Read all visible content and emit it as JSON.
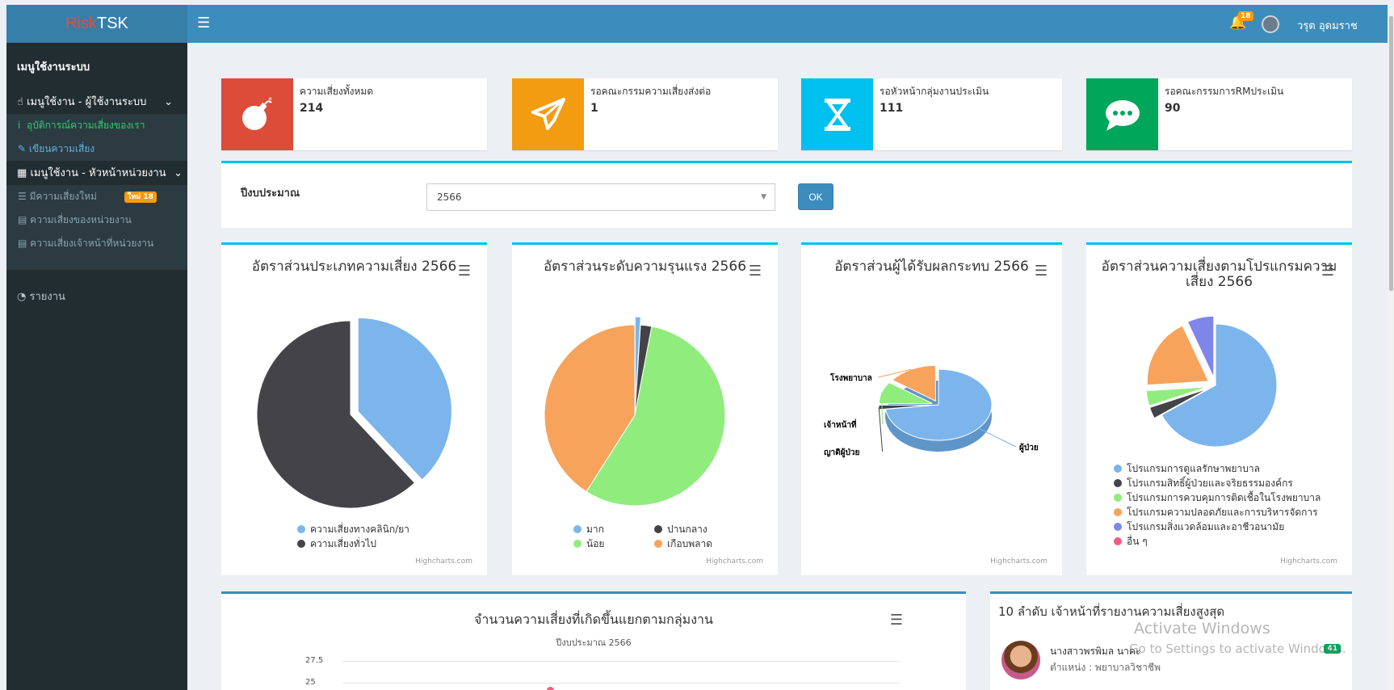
{
  "app": {
    "logo_risk": "Risk",
    "logo_tsk": "TSK"
  },
  "topbar": {
    "notif_count": "18",
    "username": "วรุต อุดมราช"
  },
  "sidebar": {
    "header": "เมนูใช้งานระบบ",
    "group1": "เมนูใช้งาน - ผู้ใช้งานระบบ",
    "group1_items": [
      "อุบัติการณ์ความเสี่ยงของเรา",
      "เขียนความเสี่ยง"
    ],
    "group2": "เมนูใช้งาน - หัวหน้าหน่วยงาน",
    "group2_items": [
      "มีความเสี่ยงใหม่",
      "ความเสี่ยงของหน่วยงาน",
      "ความเสี่ยงเจ้าหน้าที่หน่วยงาน"
    ],
    "new_badge": "ใหม่ 18",
    "report": "รายงาน"
  },
  "info_boxes": [
    {
      "title": "ความเสี่ยงทั้งหมด",
      "value": "214",
      "color": "#dd4b39",
      "icon": "bomb-icon"
    },
    {
      "title": "รอคณะกรรมความเสี่ยงส่งต่อ",
      "value": "1",
      "color": "#f39c12",
      "icon": "paper-plane-icon"
    },
    {
      "title": "รอหัวหน้ากลุ่มงานประเมิน",
      "value": "111",
      "color": "#00c0ef",
      "icon": "hourglass-icon"
    },
    {
      "title": "รอคณะกรรมการRMประเมิน",
      "value": "90",
      "color": "#00a65a",
      "icon": "comment-icon"
    }
  ],
  "filter": {
    "label": "ปีงบประมาณ",
    "selected": "2566",
    "ok_label": "OK"
  },
  "charts": {
    "credit": "Highcharts.com",
    "c1_title": "อัตราส่วนประเภทความเสี่ยง 2566",
    "c2_title": "อัตราส่วนระดับความรุนแรง 2566",
    "c3_title": "อัตราส่วนผู้ได้รับผลกระทบ 2566",
    "c4_title": "อัตราส่วนความเสี่ยงตามโปรแกรมความเสี่ยง 2566"
  },
  "chart_data": [
    {
      "type": "pie",
      "title": "อัตราส่วนประเภทความเสี่ยง 2566",
      "categories": [
        "ความเสี่ยงทางคลินิก/ยา",
        "ความเสี่ยงทั่วไป"
      ],
      "values": [
        38,
        62
      ],
      "colors": [
        "#7cb5ec",
        "#434348"
      ]
    },
    {
      "type": "pie",
      "title": "อัตราส่วนระดับความรุนแรง 2566",
      "categories": [
        "มาก",
        "ปานกลาง",
        "น้อย",
        "เกือบพลาด"
      ],
      "values": [
        1,
        2,
        56,
        41
      ],
      "colors": [
        "#7cb5ec",
        "#434348",
        "#90ed7d",
        "#f7a35c"
      ]
    },
    {
      "type": "pie",
      "title": "อัตราส่วนผู้ได้รับผลกระทบ 2566",
      "categories": [
        "ผู้ป่วย",
        "ญาติผู้ป่วย",
        "เจ้าหน้าที่",
        "โรงพยาบาล"
      ],
      "values": [
        73,
        2,
        10,
        15
      ],
      "colors": [
        "#7cb5ec",
        "#434348",
        "#90ed7d",
        "#f7a35c"
      ]
    },
    {
      "type": "pie",
      "title": "อัตราส่วนความเสี่ยงตามโปรแกรมความเสี่ยง 2566",
      "categories": [
        "โปรแกรมการดูแลรักษาพยาบาล",
        "โปรแกรมสิทธิ์ผู้ป่วยและจริยธรรมองค์กร",
        "โปรแกรมการควบคุมการติดเชื้อในโรงพยาบาล",
        "โปรแกรมความปลอดภัยและการบริหารจัดการ",
        "โปรแกรมสิ่งแวดล้อมและอาชีวอนามัย",
        "อื่น ๆ"
      ],
      "values": [
        67,
        3,
        4,
        19,
        7,
        0
      ],
      "colors": [
        "#7cb5ec",
        "#434348",
        "#90ed7d",
        "#f7a35c",
        "#8085e9",
        "#f15c80"
      ]
    },
    {
      "type": "line",
      "title": "จำนวนความเสี่ยงที่เกิดขึ้นแยกตามกลุ่มงาน",
      "subtitle": "ปีงบประมาณ 2566",
      "y_ticks": [
        "27.5",
        "25"
      ]
    }
  ],
  "top10": {
    "title": "10 ลำดับ เจ้าหน้าที่รายงานความเสี่ยงสูงสุด",
    "name": "นางสาวพรพิมล นาคะ",
    "position": "ตำแหน่ง : พยาบาลวิชาชีพ",
    "count": "41"
  },
  "watermark": {
    "line1": "Activate Windows",
    "line2": "Go to Settings to activate Windows."
  }
}
